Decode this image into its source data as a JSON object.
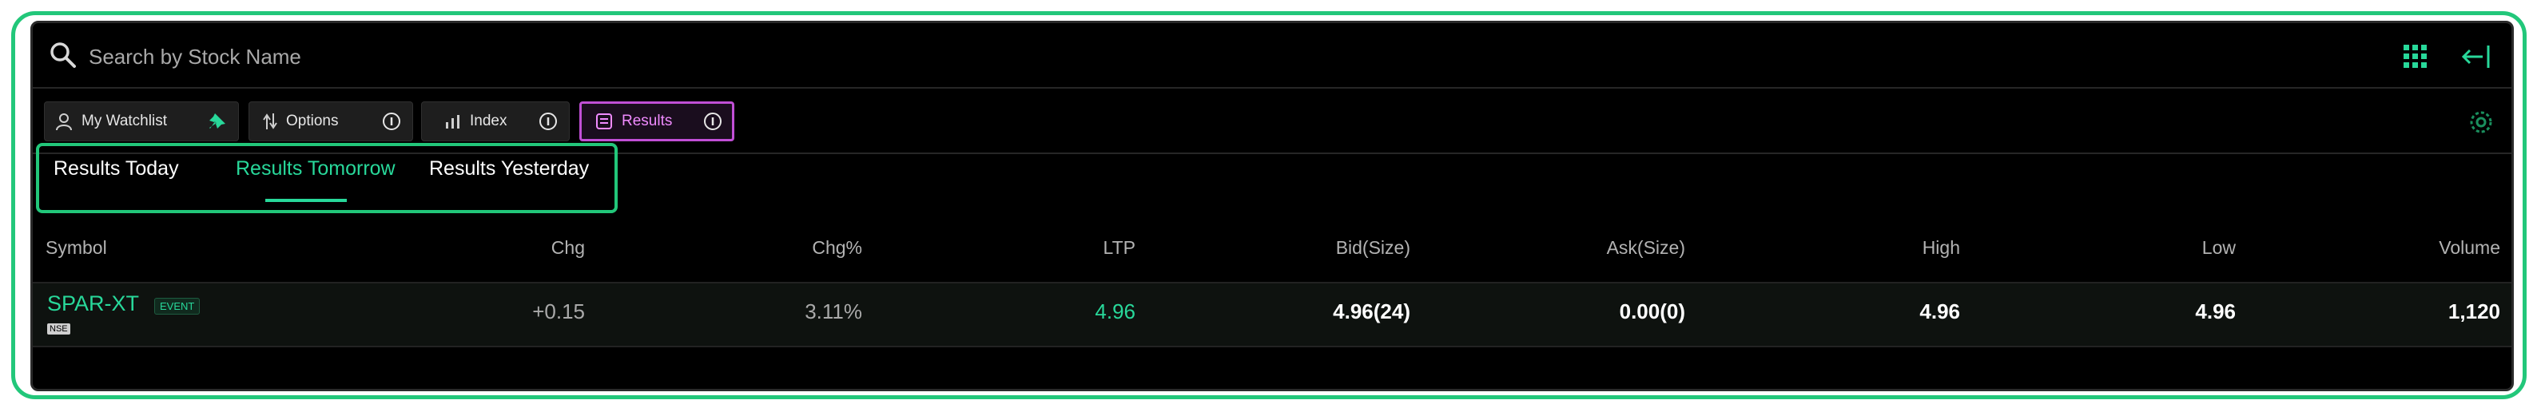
{
  "search": {
    "placeholder": "Search by Stock Name"
  },
  "filters": [
    {
      "label": "My Watchlist",
      "icon": "user-icon"
    },
    {
      "label": "Options",
      "icon": "options-icon"
    },
    {
      "label": "Index",
      "icon": "index-chart-icon"
    },
    {
      "label": "Results",
      "icon": "results-icon",
      "active": true
    }
  ],
  "tabs": [
    {
      "label": "Results Today"
    },
    {
      "label": "Results Tomorrow",
      "active": true
    },
    {
      "label": "Results Yesterday"
    }
  ],
  "table": {
    "headers": {
      "symbol": "Symbol",
      "chg": "Chg",
      "chg_pct": "Chg%",
      "ltp": "LTP",
      "bid": "Bid(Size)",
      "ask": "Ask(Size)",
      "high": "High",
      "low": "Low",
      "volume": "Volume"
    },
    "rows": [
      {
        "symbol": "SPAR-XT",
        "badge": "EVENT",
        "exchange": "NSE",
        "chg": "+0.15",
        "chg_pct": "3.11%",
        "ltp": "4.96",
        "bid": "4.96(24)",
        "ask": "0.00(0)",
        "high": "4.96",
        "low": "4.96",
        "volume": "1,120"
      }
    ]
  },
  "colors": {
    "accent": "#28d89a",
    "active_filter": "#c14fd6",
    "background": "#000000"
  }
}
